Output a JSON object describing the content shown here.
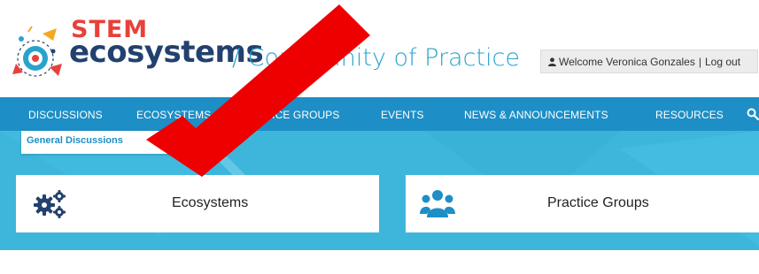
{
  "header": {
    "brand_stem": "STEM",
    "brand_ecosystems": "ecosystems",
    "brand_subtitle": "/ Community of Practice",
    "welcome_text": "Welcome Veronica Gonzales",
    "separator": "|",
    "logout_label": "Log out"
  },
  "nav": {
    "items": [
      {
        "label": "DISCUSSIONS"
      },
      {
        "label": "ECOSYSTEMS"
      },
      {
        "label": "PRACTICE GROUPS"
      },
      {
        "label": "EVENTS"
      },
      {
        "label": "NEWS & ANNOUNCEMENTS"
      },
      {
        "label": "RESOURCES"
      }
    ],
    "search_icon": "search-icon"
  },
  "dropdown": {
    "items": [
      {
        "label": "General Discussions"
      }
    ]
  },
  "cards": [
    {
      "title": "Ecosystems",
      "icon": "gears-icon"
    },
    {
      "title": "Practice Groups",
      "icon": "users-icon"
    }
  ],
  "colors": {
    "nav_bg": "#1e8ec6",
    "hero_bg": "#3eb6dc",
    "brand_red": "#e8413a",
    "brand_navy": "#22416f",
    "subtitle_blue": "#2aa3cc",
    "annotation_arrow": "#ee0000"
  }
}
